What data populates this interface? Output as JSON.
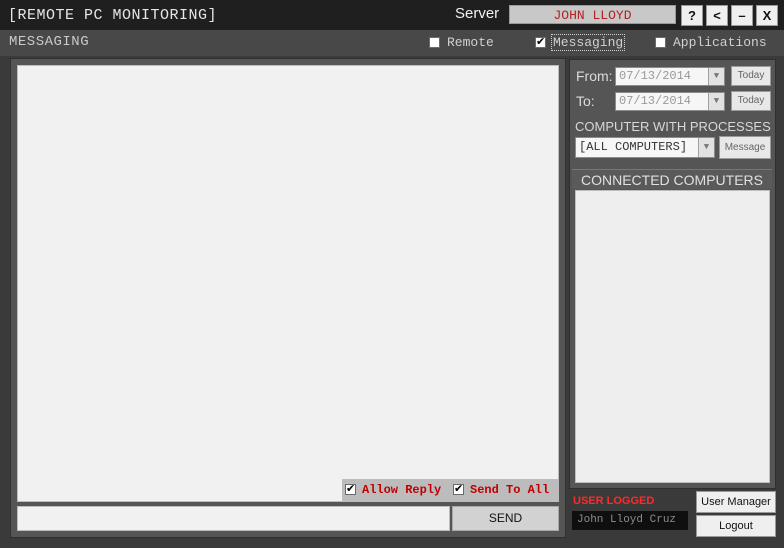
{
  "window": {
    "title": "[REMOTE PC MONITORING]",
    "server_label": "Server",
    "server_value": "JOHN LLOYD",
    "buttons": {
      "help": "?",
      "back": "<",
      "minimize": "–",
      "close": "X"
    }
  },
  "header": {
    "section_title": "MESSAGING",
    "modes": [
      {
        "label": "Remote",
        "checked": false
      },
      {
        "label": "Messaging",
        "checked": true
      },
      {
        "label": "Applications",
        "checked": false
      }
    ]
  },
  "messaging": {
    "allow_reply_label": "Allow Reply",
    "allow_reply_checked": true,
    "send_to_all_label": "Send To All",
    "send_to_all_checked": true,
    "message_input_value": "",
    "send_label": "SEND"
  },
  "filters": {
    "from_label": "From:",
    "from_value": "07/13/2014",
    "to_label": "To:",
    "to_value": "07/13/2014",
    "today_label": "Today",
    "processes_title": "COMPUTER WITH PROCESSES",
    "computer_selected": "[ALL COMPUTERS]",
    "message_button": "Message"
  },
  "connected": {
    "title": "CONNECTED COMPUTERS",
    "items": []
  },
  "user": {
    "logged_label": "USER LOGGED",
    "name": "John Lloyd Cruz",
    "user_manager_label": "User Manager",
    "logout_label": "Logout"
  }
}
